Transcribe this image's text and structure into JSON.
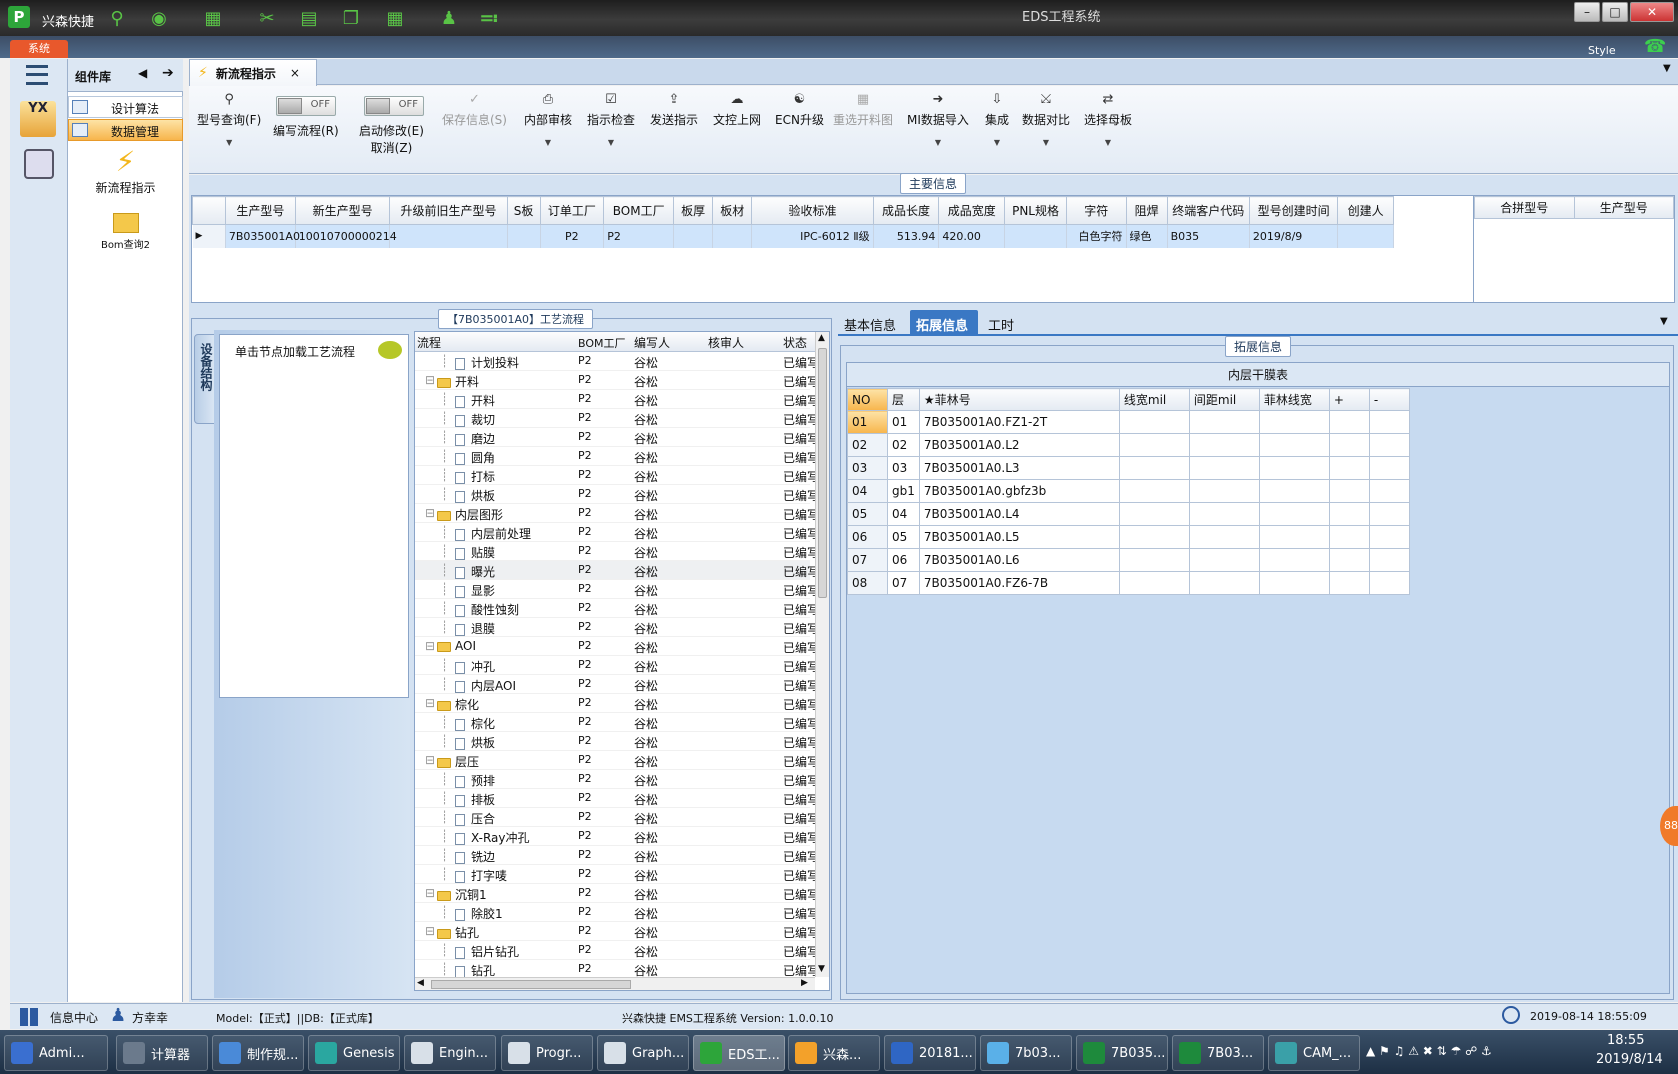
{
  "app": {
    "name": "兴森快捷",
    "window_title": "EDS工程系统",
    "style_label": "Style",
    "system_tab": "系统",
    "window_buttons": [
      "–",
      "□",
      "✕"
    ]
  },
  "left_nav": {
    "yx_label": "YX"
  },
  "component_library": {
    "title": "组件库",
    "items": [
      "设计算法",
      "数据管理"
    ],
    "modules": [
      "新流程指示",
      "Bom查询2"
    ]
  },
  "main_tab": {
    "label": "新流程指示",
    "close": "×"
  },
  "toolbar": {
    "buttons": [
      {
        "label": "型号查询(F)",
        "icon": "search-icon"
      },
      {
        "label": "编写流程(R)",
        "icon": "toggle-off"
      },
      {
        "label": "启动修改(E)",
        "icon": "toggle-off",
        "sub": "取消(Z)"
      },
      {
        "label": "保存信息(S)",
        "icon": "check-icon",
        "disabled": true
      },
      {
        "label": "内部审核",
        "icon": "printer-icon"
      },
      {
        "label": "指示检查",
        "icon": "check-box-icon"
      },
      {
        "label": "发送指示",
        "icon": "upload-icon"
      },
      {
        "label": "文控上网",
        "icon": "cloud-upload-icon"
      },
      {
        "label": "ECN升级",
        "icon": "binoculars-icon"
      },
      {
        "label": "重选开料图",
        "icon": "image-icon",
        "disabled": true
      },
      {
        "label": "MI数据导入",
        "icon": "import-icon"
      },
      {
        "label": "集成",
        "icon": "download-icon"
      },
      {
        "label": "数据对比",
        "icon": "compare-icon"
      },
      {
        "label": "选择母板",
        "icon": "shuffle-icon"
      }
    ],
    "toggle_text": "OFF"
  },
  "main_info": {
    "title": "主要信息",
    "columns": [
      "生产型号",
      "新生产型号",
      "升级前旧生产型号",
      "S板",
      "订单工厂",
      "BOM工厂",
      "板厚",
      "板材",
      "验收标准",
      "成品长度",
      "成品宽度",
      "PNL规格",
      "字符",
      "阻焊",
      "终端客户代码",
      "型号创建时间",
      "创建人"
    ],
    "row": [
      "7B035001A0",
      "10010700000214",
      "",
      "",
      "P2",
      "P2",
      "",
      "",
      "IPC-6012 Ⅱ级",
      "513.94",
      "420.00",
      "",
      "白色字符",
      "绿色",
      "B035",
      "2019/8/9",
      ""
    ],
    "side_columns": [
      "合拼型号",
      "生产型号"
    ]
  },
  "process_panel": {
    "title": "【7B035001A0】工艺流程",
    "device_tab": "设备结构",
    "hint": "单击节点加载工艺流程",
    "columns": [
      "流程",
      "BOM工厂",
      "编写人",
      "核审人",
      "状态"
    ],
    "rows": [
      {
        "name": "计划投料",
        "level": 1,
        "folder": false,
        "bom": "P2",
        "author": "谷松",
        "status": "已编写"
      },
      {
        "name": "开料",
        "level": 0,
        "folder": true,
        "bom": "P2",
        "author": "谷松",
        "status": "已编写"
      },
      {
        "name": "开料",
        "level": 1,
        "folder": false,
        "bom": "P2",
        "author": "谷松",
        "status": "已编写"
      },
      {
        "name": "裁切",
        "level": 1,
        "folder": false,
        "bom": "P2",
        "author": "谷松",
        "status": "已编写"
      },
      {
        "name": "磨边",
        "level": 1,
        "folder": false,
        "bom": "P2",
        "author": "谷松",
        "status": "已编写"
      },
      {
        "name": "圆角",
        "level": 1,
        "folder": false,
        "bom": "P2",
        "author": "谷松",
        "status": "已编写"
      },
      {
        "name": "打标",
        "level": 1,
        "folder": false,
        "bom": "P2",
        "author": "谷松",
        "status": "已编写"
      },
      {
        "name": "烘板",
        "level": 1,
        "folder": false,
        "bom": "P2",
        "author": "谷松",
        "status": "已编写"
      },
      {
        "name": "内层图形",
        "level": 0,
        "folder": true,
        "bom": "P2",
        "author": "谷松",
        "status": "已编写"
      },
      {
        "name": "内层前处理",
        "level": 1,
        "folder": false,
        "bom": "P2",
        "author": "谷松",
        "status": "已编写"
      },
      {
        "name": "贴膜",
        "level": 1,
        "folder": false,
        "bom": "P2",
        "author": "谷松",
        "status": "已编写"
      },
      {
        "name": "曝光",
        "level": 1,
        "folder": false,
        "bom": "P2",
        "author": "谷松",
        "status": "已编写"
      },
      {
        "name": "显影",
        "level": 1,
        "folder": false,
        "bom": "P2",
        "author": "谷松",
        "status": "已编写"
      },
      {
        "name": "酸性蚀刻",
        "level": 1,
        "folder": false,
        "bom": "P2",
        "author": "谷松",
        "status": "已编写"
      },
      {
        "name": "退膜",
        "level": 1,
        "folder": false,
        "bom": "P2",
        "author": "谷松",
        "status": "已编写"
      },
      {
        "name": "AOI",
        "level": 0,
        "folder": true,
        "bom": "P2",
        "author": "谷松",
        "status": "已编写"
      },
      {
        "name": "冲孔",
        "level": 1,
        "folder": false,
        "bom": "P2",
        "author": "谷松",
        "status": "已编写"
      },
      {
        "name": "内层AOI",
        "level": 1,
        "folder": false,
        "bom": "P2",
        "author": "谷松",
        "status": "已编写"
      },
      {
        "name": "棕化",
        "level": 0,
        "folder": true,
        "bom": "P2",
        "author": "谷松",
        "status": "已编写"
      },
      {
        "name": "棕化",
        "level": 1,
        "folder": false,
        "bom": "P2",
        "author": "谷松",
        "status": "已编写"
      },
      {
        "name": "烘板",
        "level": 1,
        "folder": false,
        "bom": "P2",
        "author": "谷松",
        "status": "已编写"
      },
      {
        "name": "层压",
        "level": 0,
        "folder": true,
        "bom": "P2",
        "author": "谷松",
        "status": "已编写"
      },
      {
        "name": "预排",
        "level": 1,
        "folder": false,
        "bom": "P2",
        "author": "谷松",
        "status": "已编写"
      },
      {
        "name": "排板",
        "level": 1,
        "folder": false,
        "bom": "P2",
        "author": "谷松",
        "status": "已编写"
      },
      {
        "name": "压合",
        "level": 1,
        "folder": false,
        "bom": "P2",
        "author": "谷松",
        "status": "已编写"
      },
      {
        "name": "X-Ray冲孔",
        "level": 1,
        "folder": false,
        "bom": "P2",
        "author": "谷松",
        "status": "已编写"
      },
      {
        "name": "铣边",
        "level": 1,
        "folder": false,
        "bom": "P2",
        "author": "谷松",
        "status": "已编写"
      },
      {
        "name": "打字唛",
        "level": 1,
        "folder": false,
        "bom": "P2",
        "author": "谷松",
        "status": "已编写"
      },
      {
        "name": "沉铜1",
        "level": 0,
        "folder": true,
        "bom": "P2",
        "author": "谷松",
        "status": "已编写"
      },
      {
        "name": "除胶1",
        "level": 1,
        "folder": false,
        "bom": "P2",
        "author": "谷松",
        "status": "已编写"
      },
      {
        "name": "钻孔",
        "level": 0,
        "folder": true,
        "bom": "P2",
        "author": "谷松",
        "status": "已编写"
      },
      {
        "name": "铝片钻孔",
        "level": 1,
        "folder": false,
        "bom": "P2",
        "author": "谷松",
        "status": "已编写"
      },
      {
        "name": "钻孔",
        "level": 1,
        "folder": false,
        "bom": "P2",
        "author": "谷松",
        "status": "已编写"
      }
    ]
  },
  "right_panel": {
    "tabs": [
      "基本信息",
      "拓展信息",
      "工时"
    ],
    "group_title": "拓展信息",
    "table_title": "内层干膜表",
    "columns": [
      "NO",
      "层",
      "★菲林号",
      "线宽mil",
      "间距mil",
      "菲林线宽",
      "+",
      "-"
    ],
    "rows": [
      [
        "01",
        "01",
        "7B035001A0.FZ1-2T",
        "",
        "",
        "",
        "",
        ""
      ],
      [
        "02",
        "02",
        "7B035001A0.L2",
        "",
        "",
        "",
        "",
        ""
      ],
      [
        "03",
        "03",
        "7B035001A0.L3",
        "",
        "",
        "",
        "",
        ""
      ],
      [
        "04",
        "gb1",
        "7B035001A0.gbfz3b",
        "",
        "",
        "",
        "",
        ""
      ],
      [
        "05",
        "04",
        "7B035001A0.L4",
        "",
        "",
        "",
        "",
        ""
      ],
      [
        "06",
        "05",
        "7B035001A0.L5",
        "",
        "",
        "",
        "",
        ""
      ],
      [
        "07",
        "06",
        "7B035001A0.L6",
        "",
        "",
        "",
        "",
        ""
      ],
      [
        "08",
        "07",
        "7B035001A0.FZ6-7B",
        "",
        "",
        "",
        "",
        ""
      ]
    ],
    "badge": "88"
  },
  "status_bar": {
    "info_center": "信息中心",
    "user": "方幸幸",
    "model": "Model:【正式】||DB:【正式库】",
    "version": "兴森快捷 EMS工程系统 Version: 1.0.0.10",
    "datetime": "2019-08-14 18:55:09"
  },
  "taskbar": {
    "items": [
      "Admi...",
      "计算器",
      "制作规...",
      "Genesis",
      "Engin...",
      "Progr...",
      "Graph...",
      "EDS工...",
      "兴森...",
      "20181...",
      "7b03...",
      "7B035...",
      "7B03...",
      "CAM_..."
    ],
    "time": "18:55",
    "date": "2019/8/14"
  },
  "colors": {
    "selected_row": "#cfe4fb",
    "panel_bg": "#c7daf0",
    "accent_orange": "#f7a64a"
  }
}
